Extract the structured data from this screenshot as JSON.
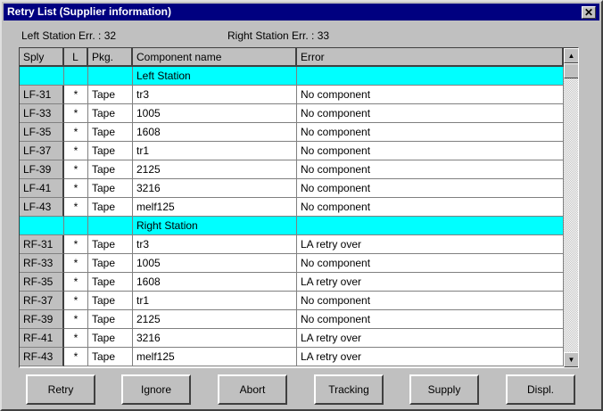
{
  "window": {
    "title": "Retry List (Supplier information)",
    "close": "✕"
  },
  "info": {
    "left": "Left Station Err. : 32",
    "right": "Right Station Err. : 33"
  },
  "columns": [
    "Sply",
    "L",
    "Pkg.",
    "Component name",
    "Error"
  ],
  "rows": [
    {
      "station": true,
      "cells": [
        "",
        "",
        "",
        "Left Station",
        ""
      ]
    },
    {
      "cells": [
        "LF-31",
        "*",
        "Tape",
        "tr3",
        "No component"
      ]
    },
    {
      "cells": [
        "LF-33",
        "*",
        "Tape",
        "1005",
        "No component"
      ]
    },
    {
      "cells": [
        "LF-35",
        "*",
        "Tape",
        "1608",
        "No component"
      ]
    },
    {
      "cells": [
        "LF-37",
        "*",
        "Tape",
        "tr1",
        "No component"
      ]
    },
    {
      "cells": [
        "LF-39",
        "*",
        "Tape",
        "2125",
        "No component"
      ]
    },
    {
      "cells": [
        "LF-41",
        "*",
        "Tape",
        "3216",
        "No component"
      ]
    },
    {
      "cells": [
        "LF-43",
        "*",
        "Tape",
        "melf125",
        "No component"
      ]
    },
    {
      "station": true,
      "cells": [
        "",
        "",
        "",
        "Right Station",
        ""
      ]
    },
    {
      "cells": [
        "RF-31",
        "*",
        "Tape",
        "tr3",
        "LA retry over"
      ]
    },
    {
      "cells": [
        "RF-33",
        "*",
        "Tape",
        "1005",
        "No component"
      ]
    },
    {
      "cells": [
        "RF-35",
        "*",
        "Tape",
        "1608",
        "LA retry over"
      ]
    },
    {
      "cells": [
        "RF-37",
        "*",
        "Tape",
        "tr1",
        "No component"
      ]
    },
    {
      "cells": [
        "RF-39",
        "*",
        "Tape",
        "2125",
        "No component"
      ]
    },
    {
      "cells": [
        "RF-41",
        "*",
        "Tape",
        "3216",
        "LA retry over"
      ]
    },
    {
      "cells": [
        "RF-43",
        "*",
        "Tape",
        "melf125",
        "LA retry over"
      ]
    }
  ],
  "buttons": [
    "Retry",
    "Ignore",
    "Abort",
    "Tracking",
    "Supply",
    "Displ."
  ]
}
